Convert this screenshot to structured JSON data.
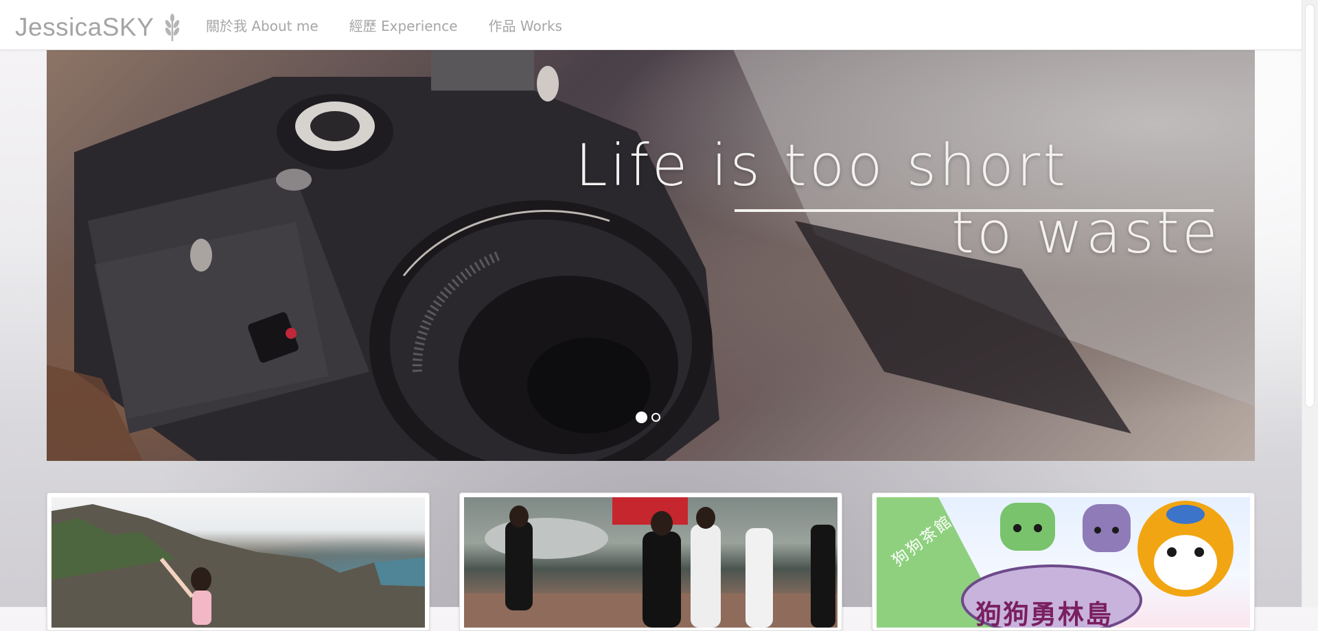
{
  "nav": {
    "brand": "JessicaSKY",
    "brand_icon": "wheat-logo-icon",
    "links": [
      "關於我 About me",
      "經歷 Experience",
      "作品 Works"
    ]
  },
  "carousel": {
    "caption_line1": "Life is too short",
    "caption_line2": "to waste",
    "slide_count": 2,
    "active_slide": 1
  },
  "cards": [
    {
      "image": "coast-photo"
    },
    {
      "image": "basketball-photo"
    },
    {
      "image": "dog-cafe-poster",
      "banner_text": "狗狗茶館",
      "title_text": "狗狗勇林島"
    }
  ],
  "colors": {
    "nav_text": "#a6a6a6",
    "brand_text": "#a4a4a4",
    "caption": "#f4f2f0",
    "ribbon": "#7dcb7b"
  }
}
